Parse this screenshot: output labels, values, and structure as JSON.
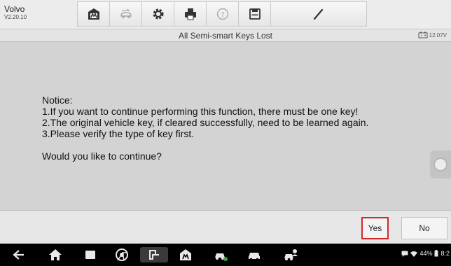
{
  "brand": {
    "name": "Volvo",
    "version": "V2.20.10"
  },
  "toolbar": {
    "tools": [
      "home-icon",
      "vehicle-swap-icon",
      "settings-icon",
      "print-icon",
      "help-icon",
      "save-icon",
      "edit-icon"
    ]
  },
  "titlebar": {
    "title": "All Semi-smart Keys Lost",
    "voltage": "12.07V"
  },
  "message": {
    "lines": [
      "Notice:",
      "1.If you want to continue performing this function, there must be one key!",
      "2.The original vehicle key, if cleared successfully, need to be learned again.",
      "3.Please verify the type of key first."
    ],
    "question": "Would you like to continue?"
  },
  "buttons": {
    "yes": "Yes",
    "no": "No"
  },
  "navbar": {
    "icons": [
      "back-icon",
      "home-icon",
      "recents-icon",
      "browser-icon",
      "vci-icon",
      "autel-home-icon",
      "vehicle-service-icon",
      "car-icon",
      "vehicle-user-icon"
    ],
    "battery": "44%",
    "time": "8:2"
  },
  "colors": {
    "highlight": "#d22a2a",
    "accent_blue": "#2a5cd0"
  }
}
